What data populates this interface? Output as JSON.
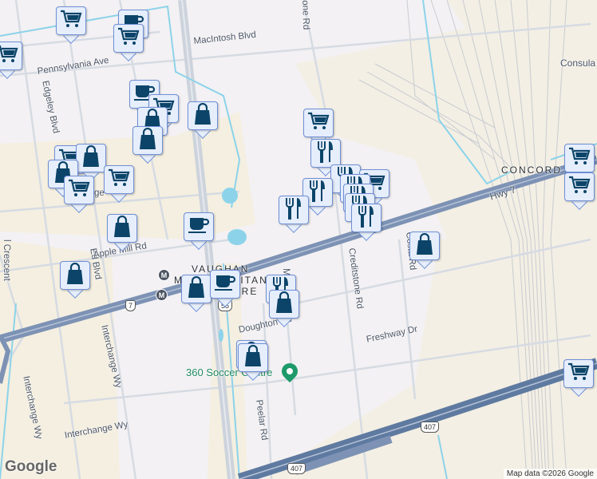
{
  "map": {
    "roads": {
      "macintosh": "MacIntosh Blvd",
      "pennsylvania": "Pennsylvania Ave",
      "edgeley_north": "Edgeley Blvd",
      "edgeley_south": "Ed    Blvd",
      "creditstone_north": "one Rd",
      "creditstone_south": "Creditstone Rd",
      "apple_mill": "Apple Mill Rd",
      "hwy7": "Hwy 7",
      "costa": "Costa Rd",
      "freshway": "Freshway Dr",
      "doughton": "Doughton Rd",
      "interchange_v": "Interchange Wy",
      "interchange_h": "Interchange Wy",
      "interchange_left": "Interchange Wy",
      "peelar": "Peelar Rd",
      "crescent": "l Crescent",
      "millway": "M",
      "partial_ge": "ge"
    },
    "places": {
      "vaughan_1": "VAUGHAN",
      "vaughan_2": "METROPOLITAN",
      "vaughan_3": "CENTRE",
      "concord": "CONCORD",
      "consulate": "Consula"
    },
    "shields": {
      "hwy7": "7",
      "hwy55": "55",
      "hwy407_a": "407",
      "hwy407_b": "407"
    },
    "transit_label": "M",
    "poi": "360 Soccer Centre",
    "attribution": "Map data ©2026 Google",
    "logo": "Google"
  },
  "markers": [
    "cart",
    "cup",
    "cart",
    "cart",
    "cup",
    "cart",
    "bag",
    "bag",
    "bag",
    "cart",
    "bag",
    "bag",
    "cart",
    "cart",
    "bag",
    "cup",
    "bag",
    "cart",
    "fork",
    "fork",
    "cart",
    "fork",
    "fork",
    "fork",
    "fork",
    "fork",
    "fork",
    "bag",
    "cart",
    "cart",
    "bag",
    "cup",
    "fork",
    "bag",
    "bag",
    "bag",
    "cart"
  ],
  "colors": {
    "marker_icon": "#0b4468",
    "marker_bg": "#e6eefc",
    "marker_border": "#6f8fd6",
    "highway": "#7d92b4",
    "water": "#8cd3ea"
  }
}
